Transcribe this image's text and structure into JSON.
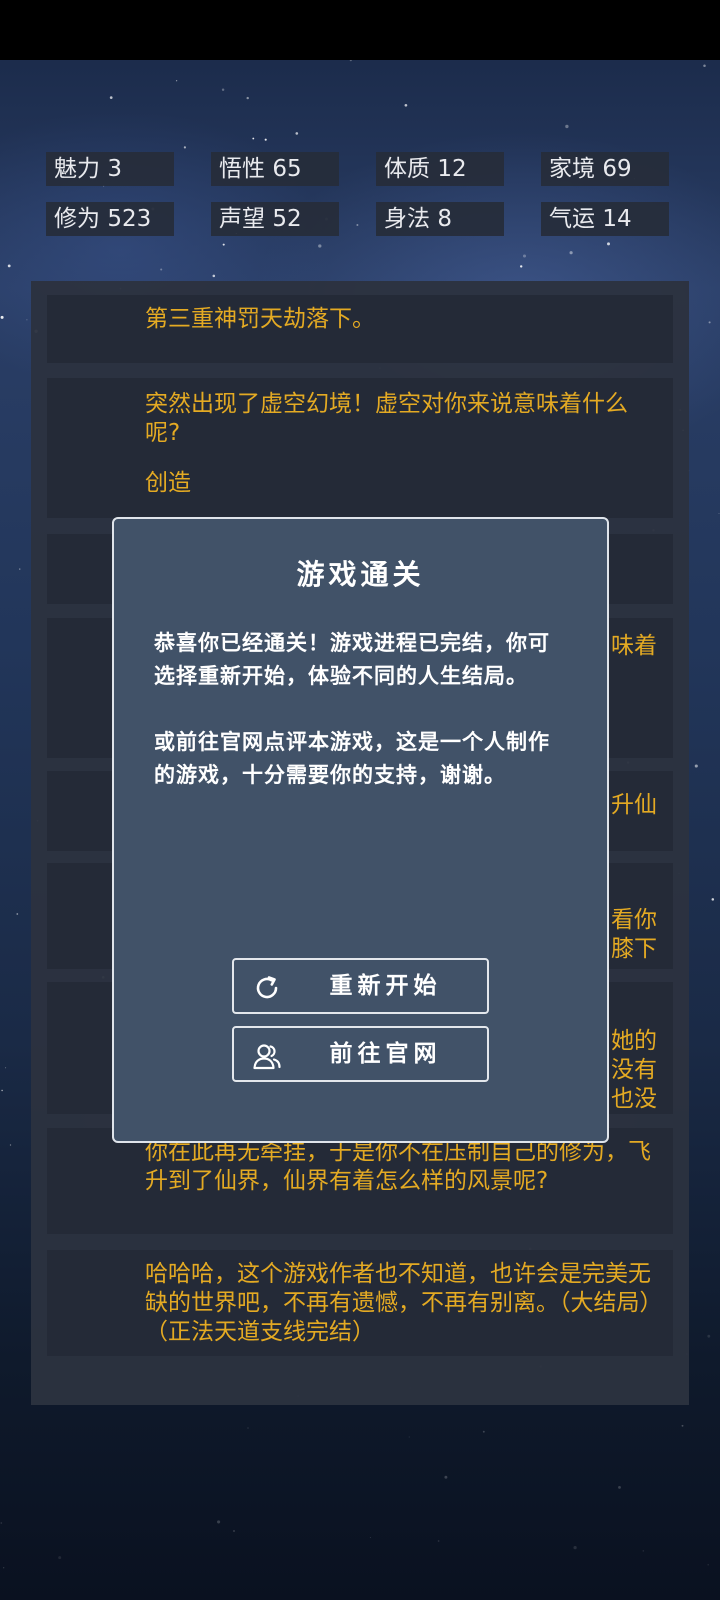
{
  "stats": [
    {
      "label": "魅力",
      "value": "3"
    },
    {
      "label": "悟性",
      "value": "65"
    },
    {
      "label": "体质",
      "value": "12"
    },
    {
      "label": "家境",
      "value": "69"
    },
    {
      "label": "修为",
      "value": "523"
    },
    {
      "label": "声望",
      "value": "52"
    },
    {
      "label": "身法",
      "value": "8"
    },
    {
      "label": "气运",
      "value": "14"
    }
  ],
  "log": {
    "entries": [
      {
        "text": "第三重神罚天劫落下。"
      },
      {
        "text": "突然出现了虚空幻境！虚空对你来说意味着什么呢?",
        "choice": "创造"
      },
      {
        "text": ""
      },
      {
        "text": "味着"
      },
      {
        "text": "升仙"
      },
      {
        "text": "看你\n膝下"
      },
      {
        "text": "她的\n没有\n也没"
      },
      {
        "text": "你在此再无牵挂，于是你不在压制自己的修为，飞升到了仙界，仙界有着怎么样的风景呢?"
      },
      {
        "text": "哈哈哈，这个游戏作者也不知道，也许会是完美无缺的世界吧，不再有遗憾，不再有别离。（大结局）（正法天道支线完结）"
      }
    ]
  },
  "modal": {
    "title": "游戏通关",
    "message_1": "恭喜你已经通关！游戏进程已完结，你可选择重新开始，体验不同的人生结局。",
    "message_2": "或前往官网点评本游戏，这是一个人制作的游戏，十分需要你的支持，谢谢。",
    "restart_label": "重新开始",
    "website_label": "前往官网",
    "restart_icon": "refresh-icon",
    "website_icon": "users-icon"
  },
  "colors": {
    "entry_text": "#e4aa23",
    "modal_bg": "#415268",
    "panel_bg": "#2c323f"
  }
}
